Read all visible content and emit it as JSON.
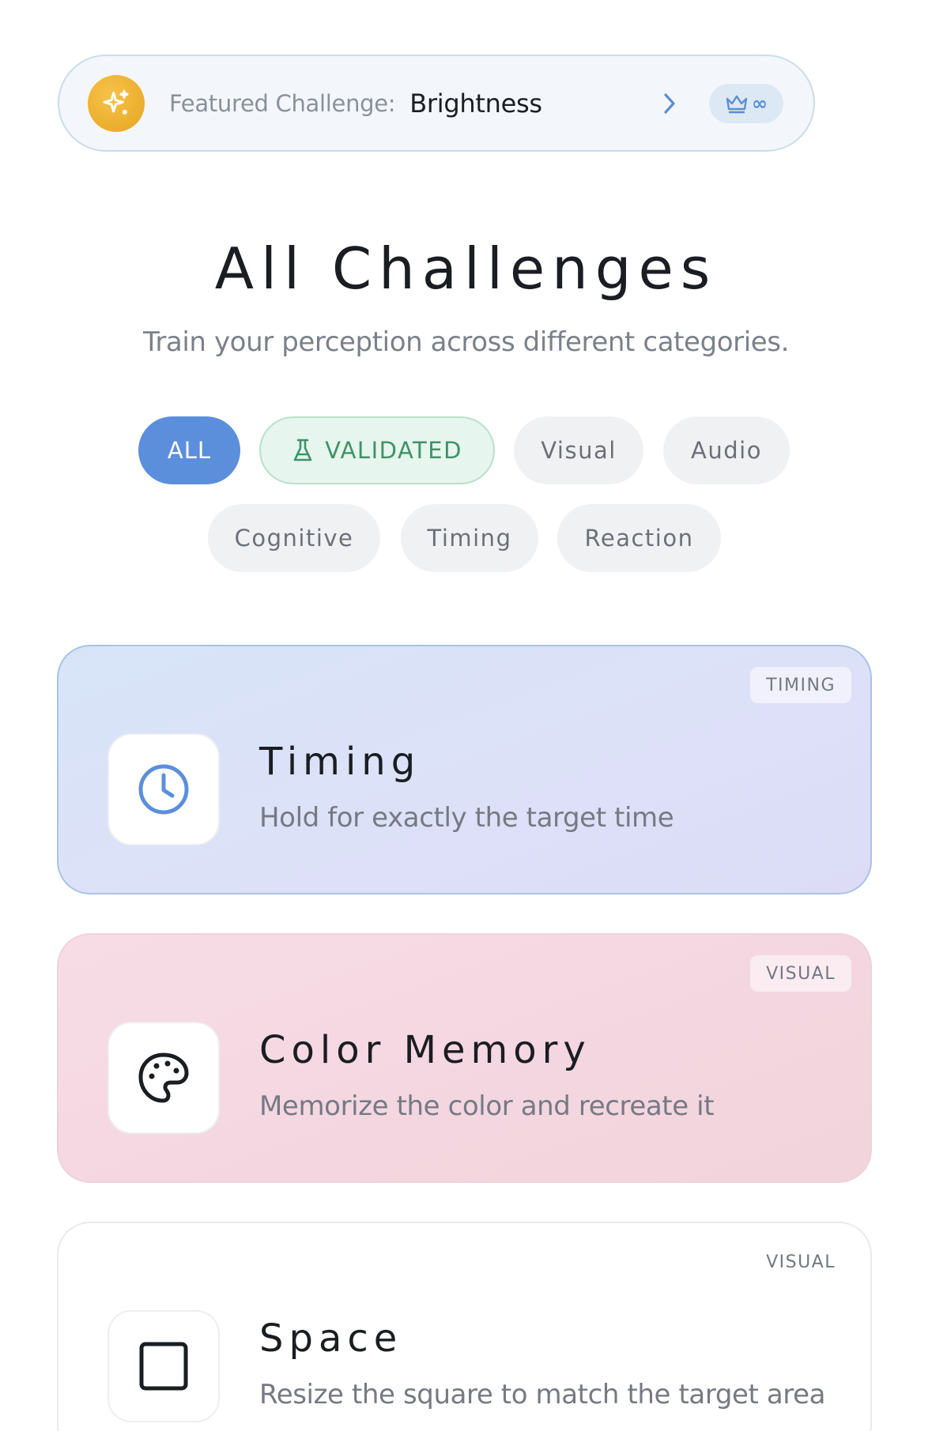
{
  "featured": {
    "label": "Featured Challenge:",
    "name": "Brightness",
    "badge_icon": "sparkle-icon",
    "premium_icon": "crown-icon",
    "premium_symbol": "∞"
  },
  "heading": {
    "title": "All Challenges",
    "subtitle": "Train your perception across different categories."
  },
  "filters": {
    "selected": "ALL",
    "items": [
      {
        "label": "ALL"
      },
      {
        "label": "VALIDATED",
        "icon": "flask-icon"
      },
      {
        "label": "Visual"
      },
      {
        "label": "Audio"
      },
      {
        "label": "Cognitive"
      },
      {
        "label": "Timing"
      },
      {
        "label": "Reaction"
      }
    ]
  },
  "challenges": [
    {
      "name": "Timing",
      "description": "Hold for exactly the target time",
      "category": "TIMING",
      "icon": "clock-icon",
      "accent": "#5b8fdc"
    },
    {
      "name": "Color Memory",
      "description": "Memorize the color and recreate it",
      "category": "VISUAL",
      "icon": "palette-icon",
      "accent": "#1a1d21"
    },
    {
      "name": "Space",
      "description": "Resize the square to match the target area",
      "category": "VISUAL",
      "icon": "square-icon",
      "accent": "#1a1d21"
    }
  ],
  "colors": {
    "accent_blue": "#5b8fdc",
    "validated_green": "#3f9366",
    "featured_gold": "#e7a51f"
  }
}
